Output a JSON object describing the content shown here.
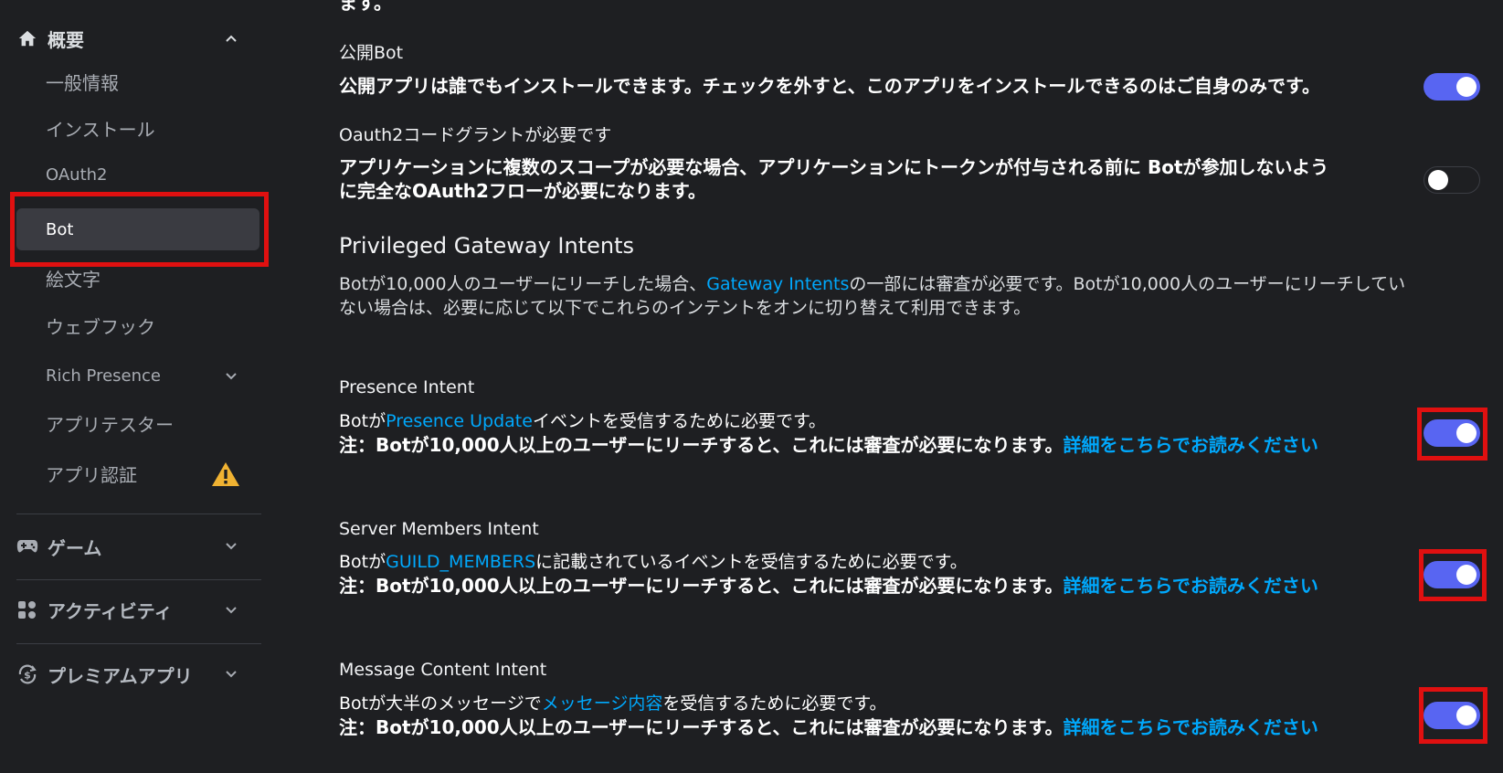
{
  "sidebar": {
    "overview": {
      "label": "概要"
    },
    "items": [
      {
        "label": "一般情報"
      },
      {
        "label": "インストール"
      },
      {
        "label": "OAuth2"
      },
      {
        "label": "Bot"
      },
      {
        "label": "絵文字"
      },
      {
        "label": "ウェブフック"
      },
      {
        "label": "Rich Presence"
      },
      {
        "label": "アプリテスター"
      },
      {
        "label": "アプリ認証"
      }
    ],
    "sections": [
      {
        "label": "ゲーム"
      },
      {
        "label": "アクティビティ"
      },
      {
        "label": "プレミアムアプリ"
      }
    ]
  },
  "main": {
    "cut_text": "ます。",
    "public_bot": {
      "title": "公開Bot",
      "description": "公開アプリは誰でもインストールできます。チェックを外すと、このアプリをインストールできるのはご自身のみです。",
      "enabled": true
    },
    "oauth2_grant": {
      "title": "Oauth2コードグラントが必要です",
      "description_line1": "アプリケーションに複数のスコープが必要な場合、アプリケーションにトークンが付与される前に Botが参加しないよう",
      "description_line2": "に完全なOAuth2フローが必要になります。",
      "enabled": false
    },
    "privileged": {
      "heading": "Privileged Gateway Intents",
      "desc_prefix": "Botが10,000人のユーザーにリーチした場合、",
      "desc_link": "Gateway Intents",
      "desc_suffix": "の一部には審査が必要です。Botが10,000人のユーザーにリーチしてい",
      "desc_line2": "ない場合は、必要に応じて以下でこれらのインテントをオンに切り替えて利用できます。"
    },
    "intents": [
      {
        "title": "Presence Intent",
        "pre": "Botが",
        "link": "Presence Update",
        "post": "イベントを受信するために必要です。",
        "note": "注：Botが10,000人以上のユーザーにリーチすると、これには審査が必要になります。",
        "note_link": "詳細をこちらでお読みください",
        "enabled": true
      },
      {
        "title": "Server Members Intent",
        "pre": "Botが",
        "link": "GUILD_MEMBERS",
        "post": "に記載されているイベントを受信するために必要です。",
        "note": "注：Botが10,000人以上のユーザーにリーチすると、これには審査が必要になります。",
        "note_link": "詳細をこちらでお読みください",
        "enabled": true
      },
      {
        "title": "Message Content Intent",
        "pre": "Botが大半のメッセージで",
        "link": "メッセージ内容",
        "post": "を受信するために必要です。",
        "note": "注：Botが10,000人以上のユーザーにリーチすると、これには審査が必要になります。",
        "note_link": "詳細をこちらでお読みください",
        "enabled": true
      }
    ]
  },
  "colors": {
    "accent": "#5865f2",
    "link": "#00a8fc",
    "highlight": "#e01010",
    "warning": "#f0b232"
  }
}
